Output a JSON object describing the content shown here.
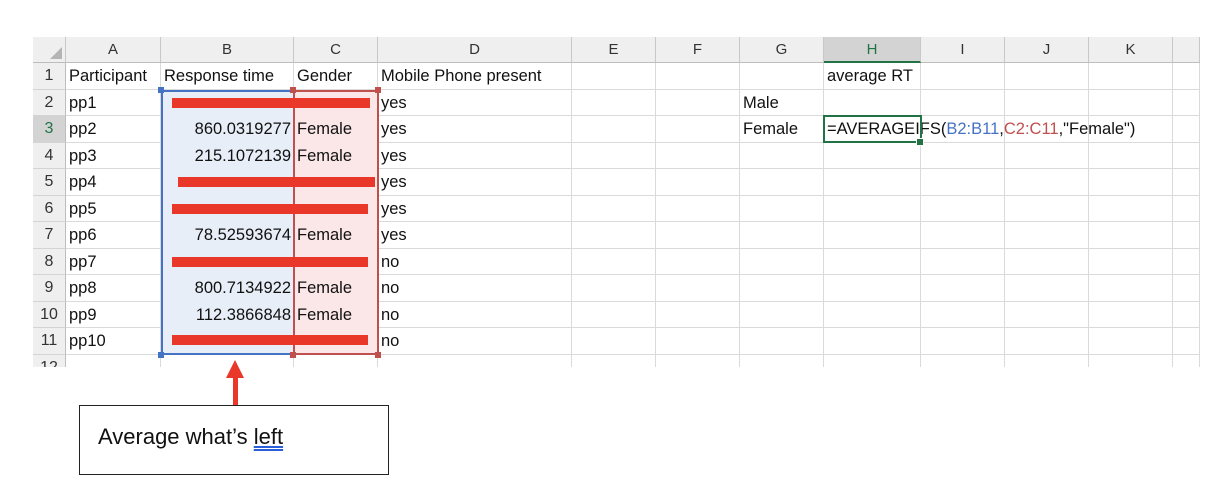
{
  "columns": [
    "A",
    "B",
    "C",
    "D",
    "E",
    "F",
    "G",
    "H",
    "I",
    "J",
    "K"
  ],
  "rows": [
    "1",
    "2",
    "3",
    "4",
    "5",
    "6",
    "7",
    "8",
    "9",
    "10",
    "11",
    "12"
  ],
  "headers": {
    "participant": "Participant",
    "response_time": "Response time",
    "gender": "Gender",
    "mobile_phone": "Mobile Phone present"
  },
  "data_rows": [
    {
      "participant": "pp1",
      "response_time": "",
      "gender": "",
      "mobile": "yes"
    },
    {
      "participant": "pp2",
      "response_time": "860.0319277",
      "gender": "Female",
      "mobile": "yes"
    },
    {
      "participant": "pp3",
      "response_time": "215.1072139",
      "gender": "Female",
      "mobile": "yes"
    },
    {
      "participant": "pp4",
      "response_time": "",
      "gender": "",
      "mobile": "yes"
    },
    {
      "participant": "pp5",
      "response_time": "",
      "gender": "",
      "mobile": "yes"
    },
    {
      "participant": "pp6",
      "response_time": "78.52593674",
      "gender": "Female",
      "mobile": "yes"
    },
    {
      "participant": "pp7",
      "response_time": "",
      "gender": "",
      "mobile": "no"
    },
    {
      "participant": "pp8",
      "response_time": "800.7134922",
      "gender": "Female",
      "mobile": "no"
    },
    {
      "participant": "pp9",
      "response_time": "112.3866848",
      "gender": "Female",
      "mobile": "no"
    },
    {
      "participant": "pp10",
      "response_time": "",
      "gender": "",
      "mobile": "no"
    }
  ],
  "summary": {
    "average_rt_header": "average RT",
    "male_label": "Male",
    "female_label": "Female"
  },
  "formula": {
    "prefix": "=AVERAGEIFS(",
    "range1": "B2:B11",
    "comma1": ",",
    "range2": "C2:C11",
    "rest": ",\"Female\")"
  },
  "callout": {
    "text_before": "Average what’s ",
    "text_link": "left"
  },
  "colors": {
    "redaction": "#e9372a",
    "range_blue": "#4472c4",
    "range_red": "#c0504d",
    "active_green": "#217346"
  }
}
